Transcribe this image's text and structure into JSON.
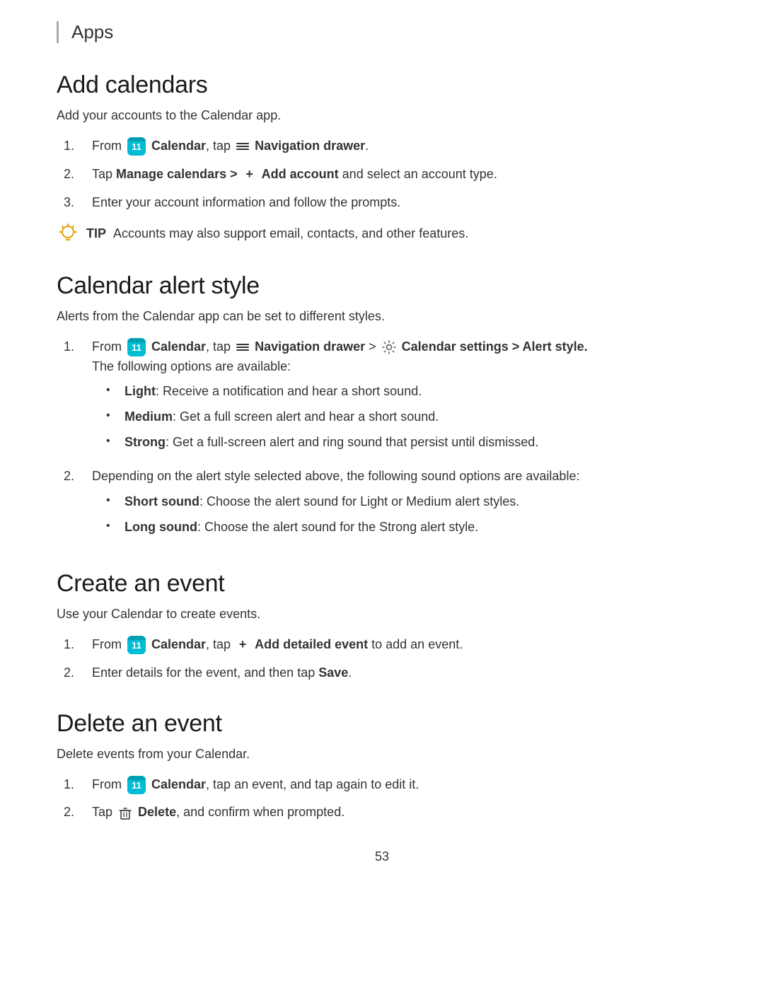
{
  "header": {
    "title": "Apps",
    "border_color": "#aaaaaa"
  },
  "sections": [
    {
      "id": "add-calendars",
      "title": "Add calendars",
      "description": "Add your accounts to the Calendar app.",
      "steps": [
        {
          "id": 1,
          "text_parts": [
            "From ",
            "calendar-icon",
            " Calendar, tap ",
            "menu-icon",
            " Navigation drawer."
          ]
        },
        {
          "id": 2,
          "text_parts": [
            "Tap ",
            "bold:Manage calendars > ",
            "plus-icon",
            " bold:Add account",
            " and select an account type."
          ]
        },
        {
          "id": 3,
          "text_parts": [
            "Enter your account information and follow the prompts."
          ]
        }
      ],
      "tip": "Accounts may also support email, contacts, and other features."
    },
    {
      "id": "calendar-alert-style",
      "title": "Calendar alert style",
      "description": "Alerts from the Calendar app can be set to different styles.",
      "steps": [
        {
          "id": 1,
          "text_parts": [
            "From ",
            "calendar-icon",
            " Calendar, tap ",
            "menu-icon",
            " Navigation drawer > ",
            "gear-icon",
            " Calendar settings > Alert style."
          ],
          "subtext": "The following options are available:",
          "bullets": [
            {
              "label": "Light",
              "text": ": Receive a notification and hear a short sound."
            },
            {
              "label": "Medium",
              "text": ": Get a full screen alert and hear a short sound."
            },
            {
              "label": "Strong",
              "text": ": Get a full-screen alert and ring sound that persist until dismissed."
            }
          ]
        },
        {
          "id": 2,
          "text": "Depending on the alert style selected above, the following sound options are available:",
          "bullets": [
            {
              "label": "Short sound",
              "text": ": Choose the alert sound for Light or Medium alert styles."
            },
            {
              "label": "Long sound",
              "text": ": Choose the alert sound for the Strong alert style."
            }
          ]
        }
      ]
    },
    {
      "id": "create-an-event",
      "title": "Create an event",
      "description": "Use your Calendar to create events.",
      "steps": [
        {
          "id": 1,
          "text_parts": [
            "From ",
            "calendar-icon",
            " Calendar, tap ",
            "plus-icon",
            " Add detailed event to add an event."
          ]
        },
        {
          "id": 2,
          "text": "Enter details for the event, and then tap ",
          "bold_end": "Save."
        }
      ]
    },
    {
      "id": "delete-an-event",
      "title": "Delete an event",
      "description": "Delete events from your Calendar.",
      "steps": [
        {
          "id": 1,
          "text_parts": [
            "From ",
            "calendar-icon",
            " Calendar, tap an event, and tap again to edit it."
          ]
        },
        {
          "id": 2,
          "text_parts": [
            "Tap ",
            "trash-icon",
            " Delete, and confirm when prompted."
          ]
        }
      ]
    }
  ],
  "page_number": "53",
  "labels": {
    "tip": "TIP",
    "bold_manage_calendars": "Manage calendars >",
    "bold_add_account": "Add account",
    "bold_navigation_drawer": "Navigation drawer",
    "bold_calendar": "Calendar",
    "bold_calendar_settings": "Calendar settings",
    "bold_alert_style": "Alert style.",
    "bold_add_detailed_event": "Add detailed event",
    "bold_save": "Save.",
    "bold_delete": "Delete",
    "tip_text": "Accounts may also support email, contacts, and other features."
  }
}
